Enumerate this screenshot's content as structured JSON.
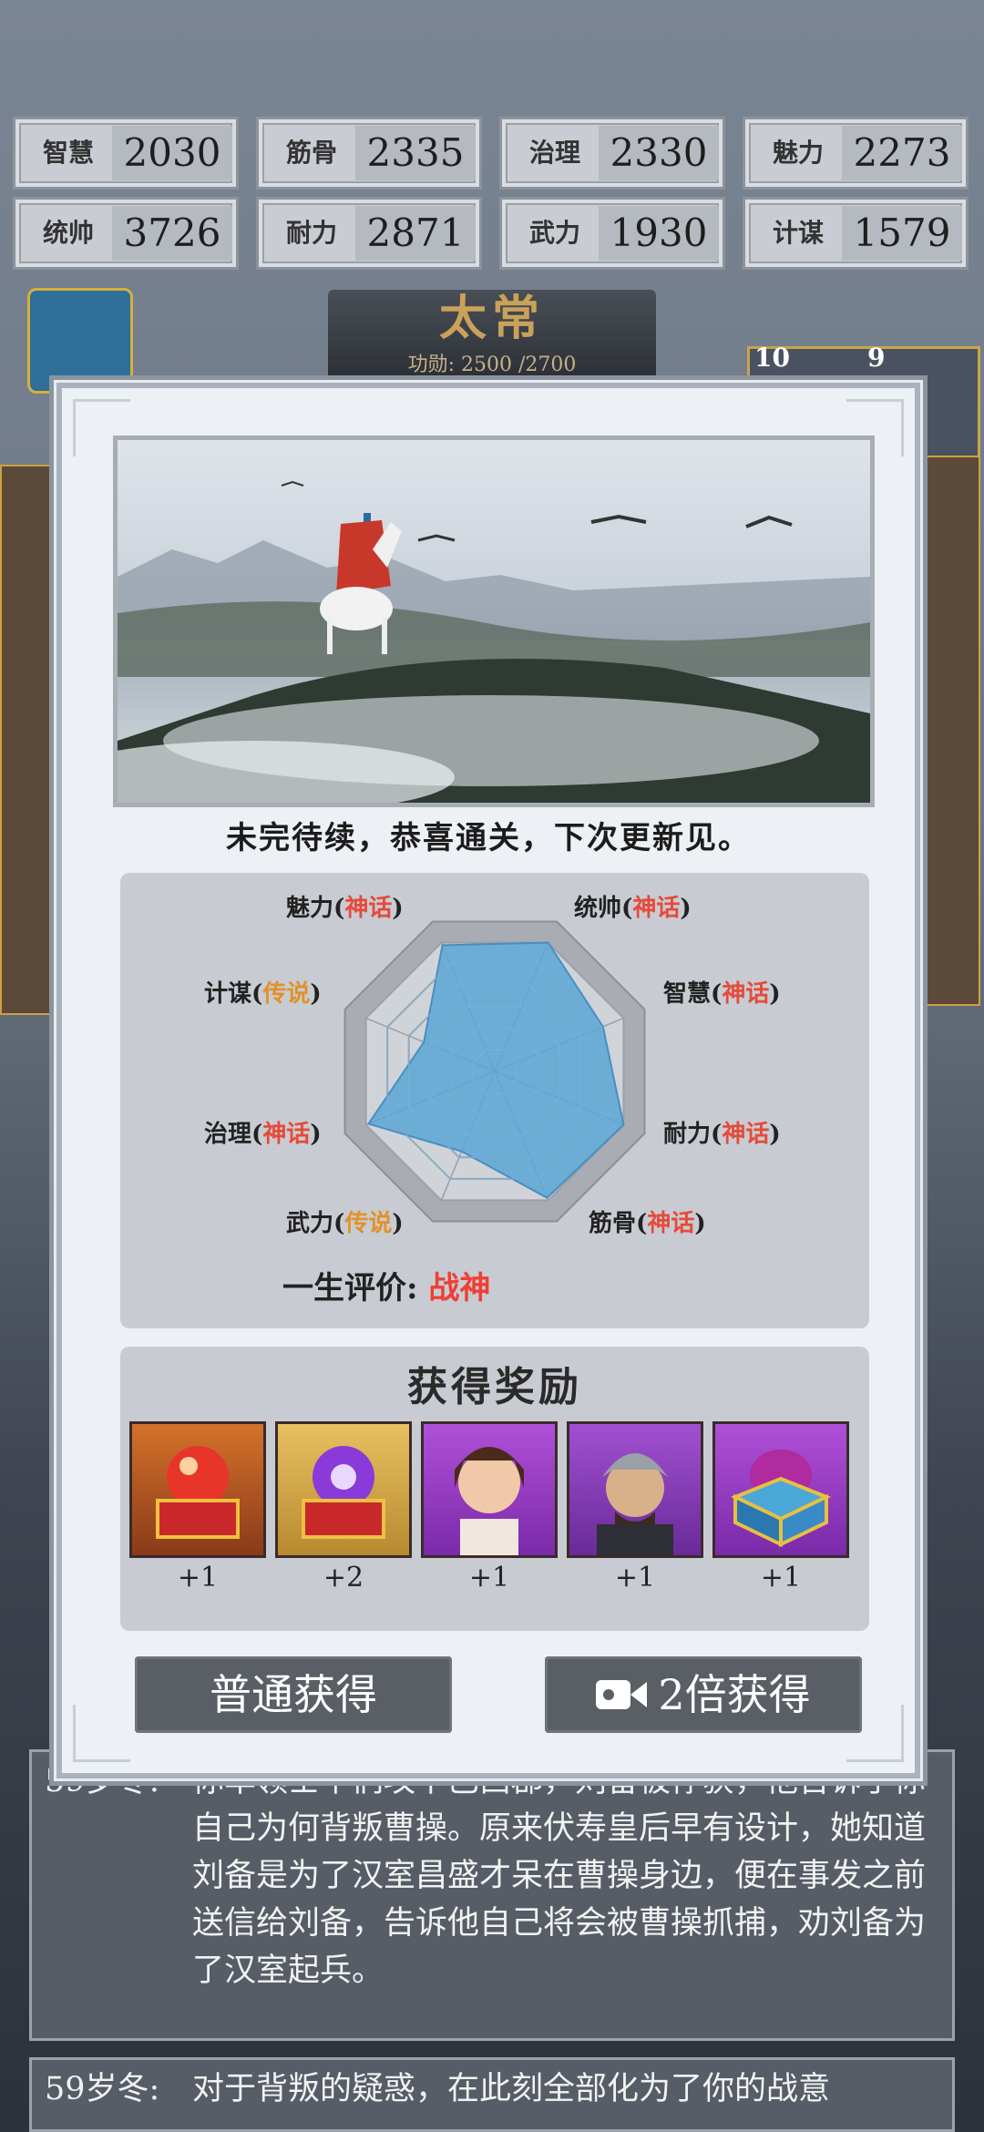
{
  "stats": [
    {
      "label": "智慧",
      "value": "2030"
    },
    {
      "label": "筋骨",
      "value": "2335"
    },
    {
      "label": "治理",
      "value": "2330"
    },
    {
      "label": "魅力",
      "value": "2273"
    },
    {
      "label": "统帅",
      "value": "3726"
    },
    {
      "label": "耐力",
      "value": "2871"
    },
    {
      "label": "武力",
      "value": "1930"
    },
    {
      "label": "计谋",
      "value": "1579"
    }
  ],
  "rank": {
    "title": "太常",
    "merit": "功勋: 2500 /2700"
  },
  "badges": [
    "10",
    "9"
  ],
  "headline": "未完待续，恭喜通关，下次更新见。",
  "radar": {
    "labels": [
      {
        "name": "魅力",
        "grade": "神话"
      },
      {
        "name": "统帅",
        "grade": "神话"
      },
      {
        "name": "智慧",
        "grade": "神话"
      },
      {
        "name": "耐力",
        "grade": "神话"
      },
      {
        "name": "筋骨",
        "grade": "神话"
      },
      {
        "name": "武力",
        "grade": "传说"
      },
      {
        "name": "治理",
        "grade": "神话"
      },
      {
        "name": "计谋",
        "grade": "传说"
      }
    ],
    "lifetime_label": "一生评价:",
    "lifetime_value": "战神",
    "colors": {
      "mythic": "#e64a3a",
      "legend": "#e0922a",
      "fill": "#5aa6d6"
    }
  },
  "rewards": {
    "title": "获得奖励",
    "items": [
      {
        "icon": "red-orb-chest-icon",
        "count": "+1"
      },
      {
        "icon": "purple-orb-chest-icon",
        "count": "+2"
      },
      {
        "icon": "female-general-portrait",
        "count": "+1"
      },
      {
        "icon": "male-general-portrait",
        "count": "+1"
      },
      {
        "icon": "purple-gem-box-icon",
        "count": "+1"
      }
    ]
  },
  "buttons": {
    "normal": "普通获得",
    "double": "2倍获得"
  },
  "log": [
    {
      "age": "59岁冬:",
      "text": "你率领士卒们攻下巴西郡，刘备被俘获，他告诉了你自己为何背叛曹操。原来伏寿皇后早有设计，她知道刘备是为了汉室昌盛才呆在曹操身边，便在事发之前送信给刘备，告诉他自己将会被曹操抓捕，劝刘备为了汉室起兵。"
    },
    {
      "age": "59岁冬:",
      "text": "对于背叛的疑惑，在此刻全部化为了你的战意"
    }
  ]
}
